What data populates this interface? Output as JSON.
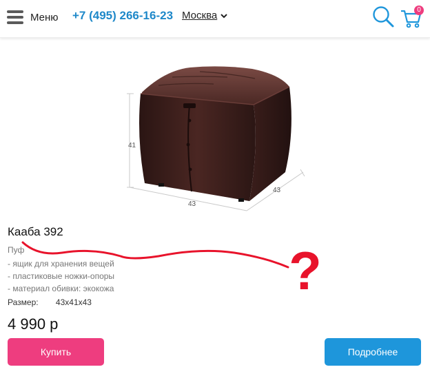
{
  "header": {
    "menu_label": "Меню",
    "phone": "+7 (495) 266-16-23",
    "city": "Москва",
    "cart_count": "0",
    "icons": [
      "menu-icon",
      "chevron-down-icon",
      "search-icon",
      "cart-icon"
    ]
  },
  "product": {
    "image_dimensions": {
      "height": "41",
      "depth": "43",
      "width": "43"
    },
    "title": "Кааба 392",
    "type": "Пуф",
    "features": [
      "- ящик для хранения вещей",
      "- пластиковые ножки-опоры",
      "- материал обивки: экокожа"
    ],
    "size_label": "Размер:",
    "size_value": "43x41x43",
    "price": "4 990 р"
  },
  "actions": {
    "buy_label": "Купить",
    "details_label": "Подробнее"
  },
  "annotation": {
    "mark": "?"
  },
  "colors": {
    "accent_blue": "#1e96db",
    "accent_pink": "#ee3d7f",
    "annotation_red": "#e8132b"
  }
}
